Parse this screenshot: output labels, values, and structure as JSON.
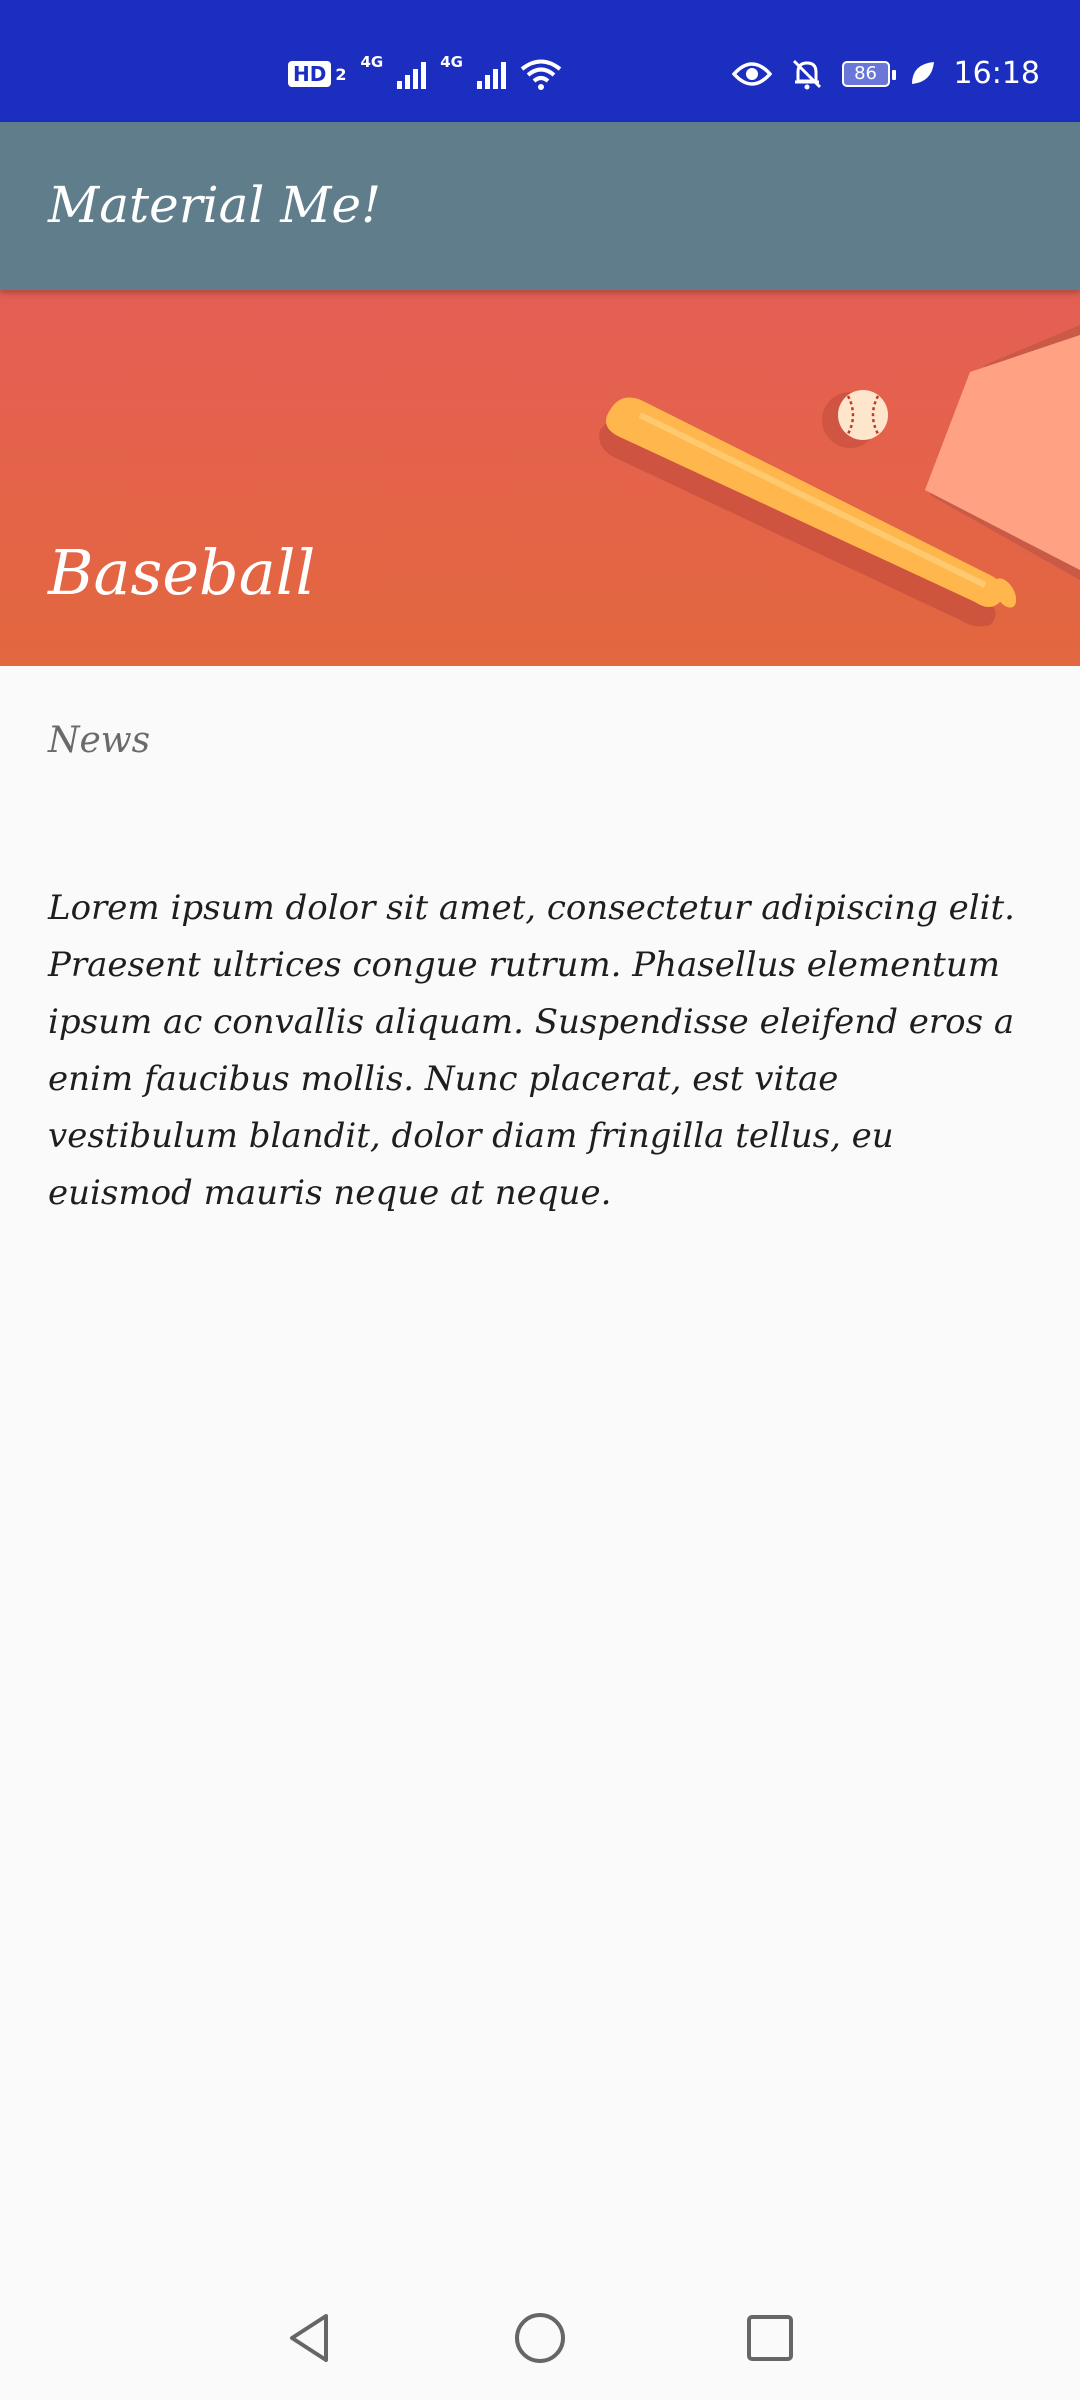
{
  "status_bar": {
    "hd_label": "HD",
    "hd_sub": "2",
    "net1": "4G",
    "net2": "4G",
    "battery": "86",
    "time": "16:18",
    "icons": [
      "signal-icon",
      "wifi-icon",
      "eye-icon",
      "bell-off-icon",
      "battery-icon",
      "leaf-icon"
    ]
  },
  "app_bar": {
    "title": "Material Me!",
    "color": "#607d8b"
  },
  "card": {
    "title": "Baseball",
    "subtitle": "News",
    "body": "Lorem ipsum dolor sit amet, consectetur adipiscing elit. Praesent ultrices congue rutrum. Phasellus elementum ipsum ac convallis aliquam. Suspendisse eleifend eros a enim faucibus mollis. Nunc placerat, est vitae vestibulum blandit, dolor diam fringilla tellus, eu euismod mauris neque at neque.",
    "image": "baseball-bat-and-ball"
  },
  "nav_bar": {
    "icons": [
      "back-icon",
      "home-icon",
      "recents-icon"
    ]
  }
}
